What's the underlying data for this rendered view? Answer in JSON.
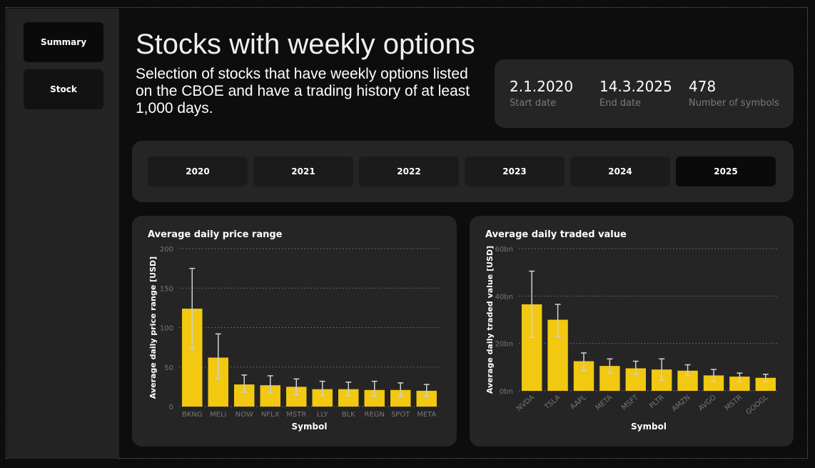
{
  "nav": {
    "summary_label": "Summary",
    "stock_label": "Stock",
    "active": "Summary"
  },
  "header": {
    "title": "Stocks with weekly options",
    "subtitle": "Selection of stocks that have weekly options listed on the CBOE and have a trading history of at least 1,000 days."
  },
  "kpis": [
    {
      "value": "2.1.2020",
      "label": "Start date"
    },
    {
      "value": "14.3.2025",
      "label": "End date"
    },
    {
      "value": "478",
      "label": "Number of symbols"
    }
  ],
  "years": {
    "items": [
      "2020",
      "2021",
      "2022",
      "2023",
      "2024",
      "2025"
    ],
    "active": "2025"
  },
  "colors": {
    "bar": "#f2c811",
    "panel": "#252525",
    "background": "#0d0d0d",
    "errorbar": "#d0d0d0"
  },
  "chart_data": [
    {
      "type": "bar",
      "title": "Average daily price range",
      "xlabel": "Symbol",
      "ylabel": "Average daily price range [USD]",
      "ylim": [
        0,
        200
      ],
      "yticks": [
        0,
        50,
        100,
        150,
        200
      ],
      "ytick_labels": [
        "0",
        "50",
        "100",
        "150",
        "200"
      ],
      "grid": "horizontal dotted",
      "categories": [
        "BKNG",
        "MELI",
        "NOW",
        "NFLX",
        "MSTR",
        "LLY",
        "BLK",
        "REGN",
        "SPOT",
        "META"
      ],
      "values": [
        124,
        62,
        28,
        27,
        25,
        22,
        22,
        21,
        21,
        20
      ],
      "err_low": [
        73,
        35,
        18,
        17,
        15,
        14,
        14,
        13,
        13,
        13
      ],
      "err_high": [
        175,
        92,
        40,
        39,
        35,
        32,
        31,
        32,
        30,
        28
      ],
      "xtick_rotation": 0
    },
    {
      "type": "bar",
      "title": "Average daily traded value",
      "xlabel": "Symbol",
      "ylabel": "Average daily traded value [USD]",
      "ylim": [
        0,
        60
      ],
      "yticks": [
        0,
        20,
        40,
        60
      ],
      "ytick_labels": [
        "0bn",
        "20bn",
        "40bn",
        "60bn"
      ],
      "grid": "horizontal dotted",
      "categories": [
        "NVDA",
        "TSLA",
        "AAPL",
        "META",
        "MSFT",
        "PLTR",
        "AMZN",
        "AVGO",
        "MSTR",
        "GOOGL"
      ],
      "values": [
        36.5,
        30,
        12.5,
        10.5,
        9.5,
        9,
        8.5,
        6.5,
        6,
        5.5
      ],
      "err_low": [
        22.5,
        23,
        8.5,
        7.5,
        7,
        4.5,
        6.5,
        4,
        4,
        4
      ],
      "err_high": [
        50.5,
        36.5,
        16,
        13.5,
        12.5,
        13.5,
        11,
        9,
        7.5,
        7
      ],
      "xtick_rotation": -40
    }
  ]
}
